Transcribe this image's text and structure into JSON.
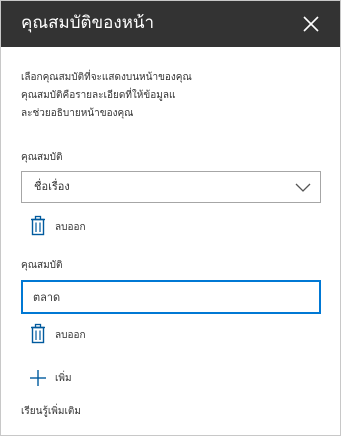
{
  "header": {
    "title": "คุณสมบัติของหน้า",
    "close_icon": "close-icon",
    "background": "#333333"
  },
  "description": {
    "line1": "เลือกคุณสมบัติที่จะแสดงบนหน้าของคุณ",
    "line2": "คุณสมบัติคือรายละเอียดที่ให้ข้อมูลแ",
    "line3": "ละช่วยอธิบายหน้าของคุณ"
  },
  "properties": [
    {
      "label": "คุณสมบัติ",
      "control": "dropdown",
      "value": "ชื่อเรื่อง",
      "remove_label": "ลบออก",
      "remove_icon": "trash-icon"
    },
    {
      "label": "คุณสมบัติ",
      "control": "text-input",
      "value": "ตลาด",
      "remove_label": "ลบออก",
      "remove_icon": "trash-icon"
    }
  ],
  "add": {
    "label": "เพิ่ม",
    "icon": "plus-icon"
  },
  "learn_more": "เรียนรู้เพิ่มเติม",
  "colors": {
    "accent": "#0078d4",
    "icon_blue": "#005a9e",
    "border": "#a6a6a6"
  }
}
